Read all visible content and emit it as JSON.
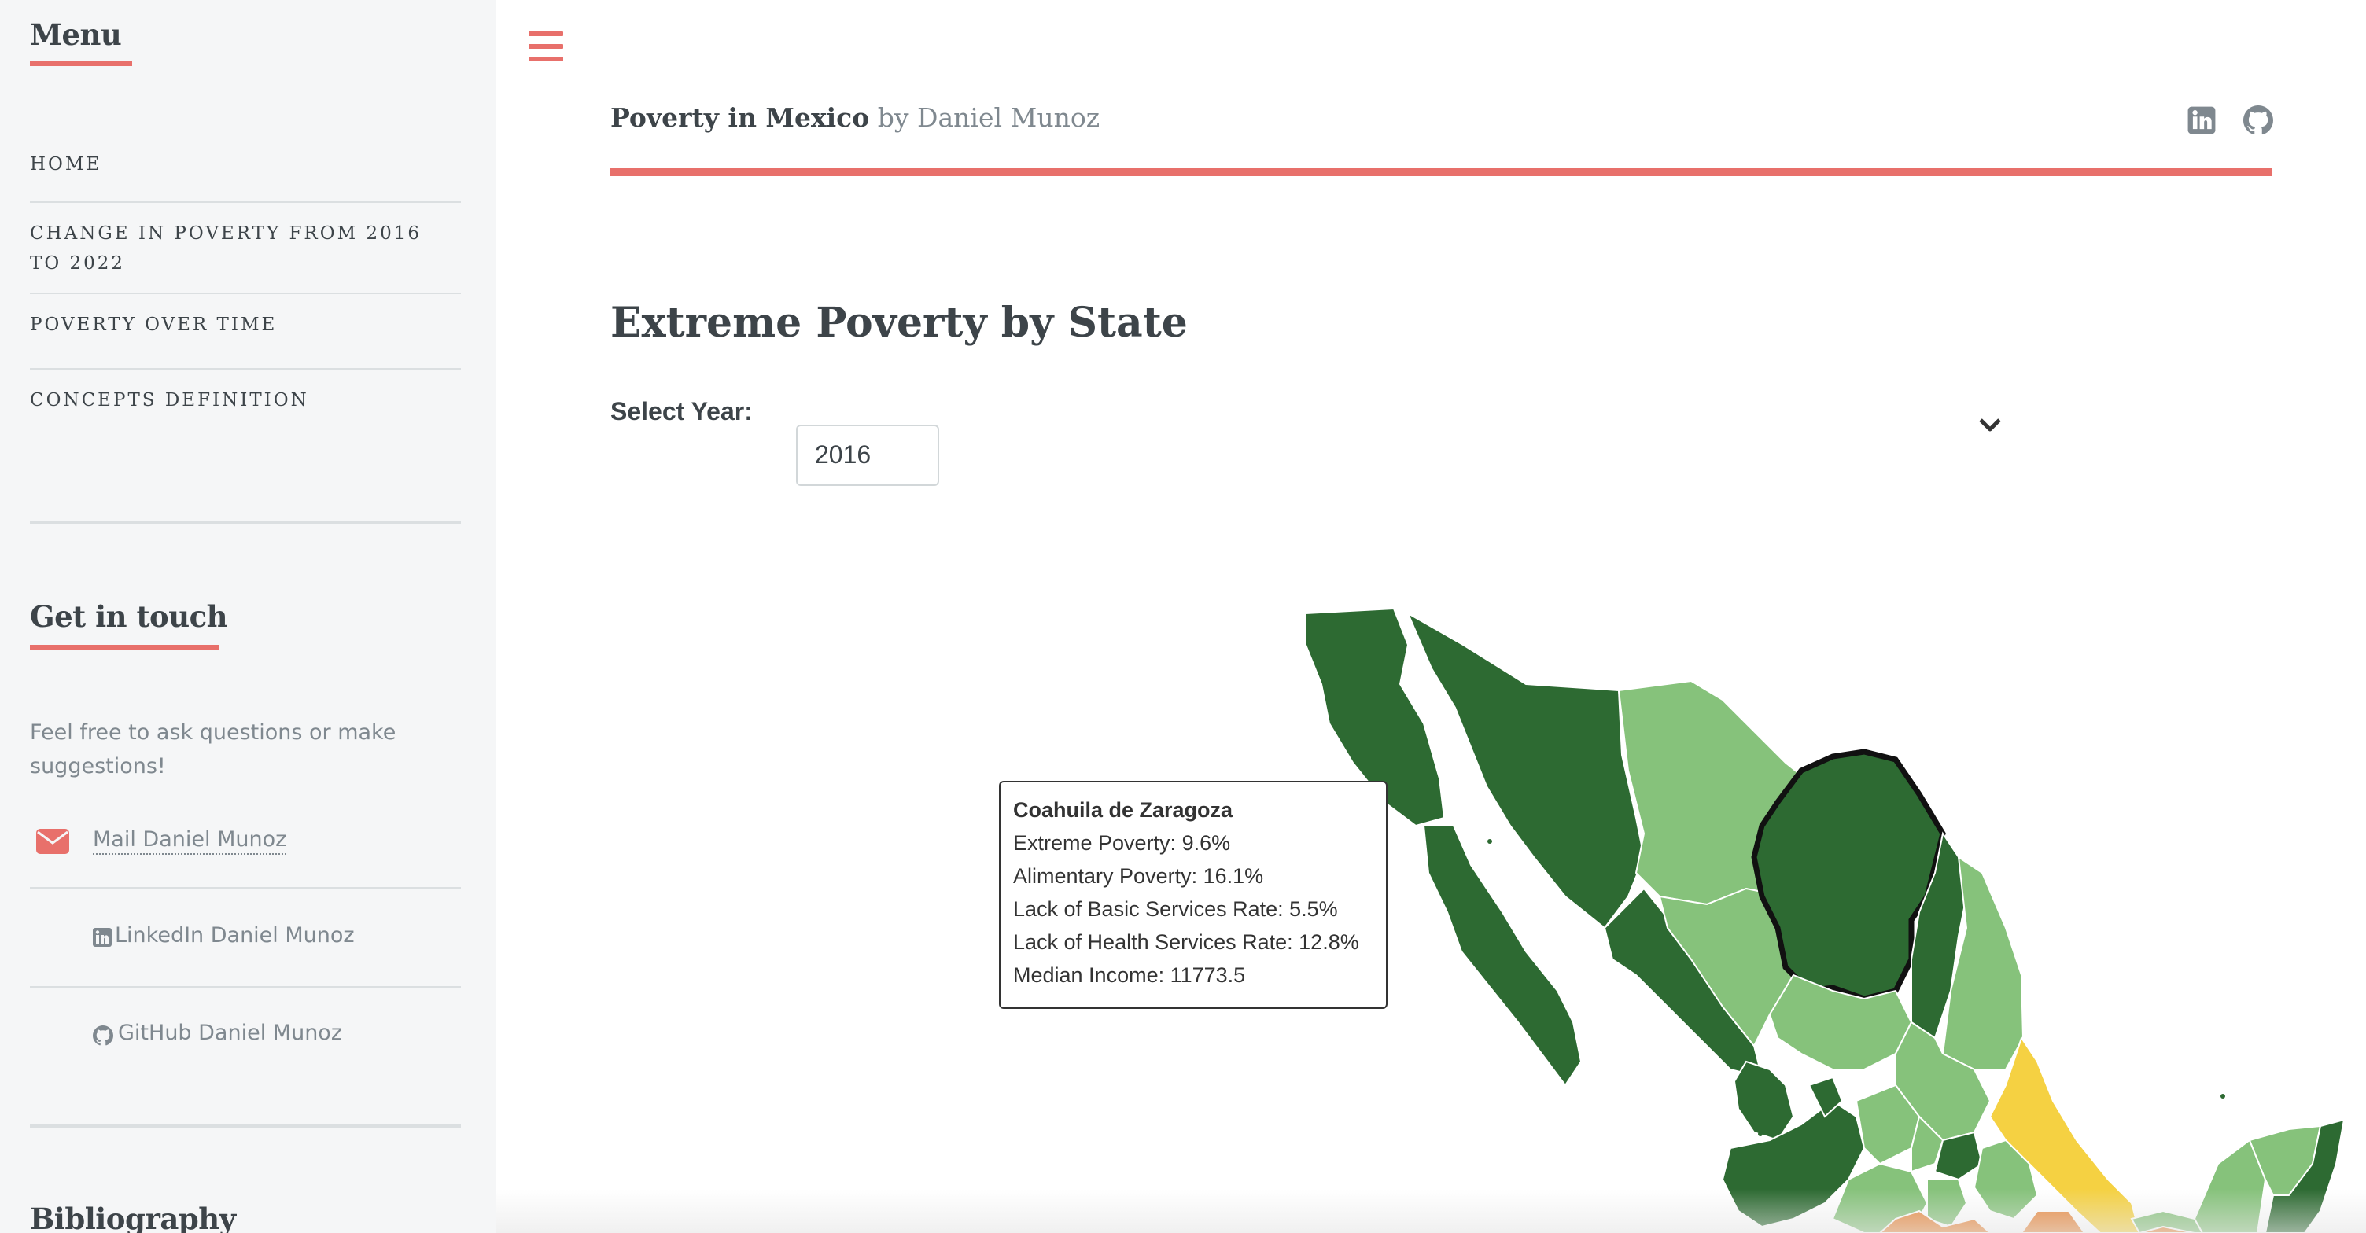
{
  "sidebar": {
    "menu_title": "Menu",
    "menu_items": [
      {
        "label": "HOME"
      },
      {
        "label": "CHANGE IN POVERTY FROM 2016 TO 2022"
      },
      {
        "label": "POVERTY OVER TIME"
      },
      {
        "label": "CONCEPTS DEFINITION"
      }
    ],
    "contact_title": "Get in touch",
    "contact_text": "Feel free to ask questions or make suggestions!",
    "contacts": [
      {
        "label": "Mail Daniel Munoz",
        "icon": "envelope-icon"
      },
      {
        "label": "LinkedIn Daniel Munoz",
        "icon": "linkedin-icon"
      },
      {
        "label": "GitHub Daniel Munoz",
        "icon": "github-icon"
      }
    ],
    "bibliography_title": "Bibliography"
  },
  "header": {
    "title": "Poverty in Mexico",
    "by": "by Daniel Munoz",
    "icons": [
      "linkedin-icon",
      "github-icon"
    ]
  },
  "main": {
    "heading": "Extreme Poverty by State",
    "select_label": "Select Year:",
    "select_value": "2016"
  },
  "tooltip": {
    "state": "Coahuila de Zaragoza",
    "lines": [
      "Extreme Poverty: 9.6%",
      "Alimentary Poverty: 16.1%",
      "Lack of Basic Services Rate: 5.5%",
      "Lack of Health Services Rate: 12.8%",
      "Median Income: 11773.5"
    ]
  },
  "colors": {
    "accent": "#e8706b",
    "dark_green": "#2d6a32",
    "light_green": "#86c27b",
    "mid_green": "#6aaa5c",
    "yellow": "#f5d142",
    "orange": "#e8873c"
  }
}
